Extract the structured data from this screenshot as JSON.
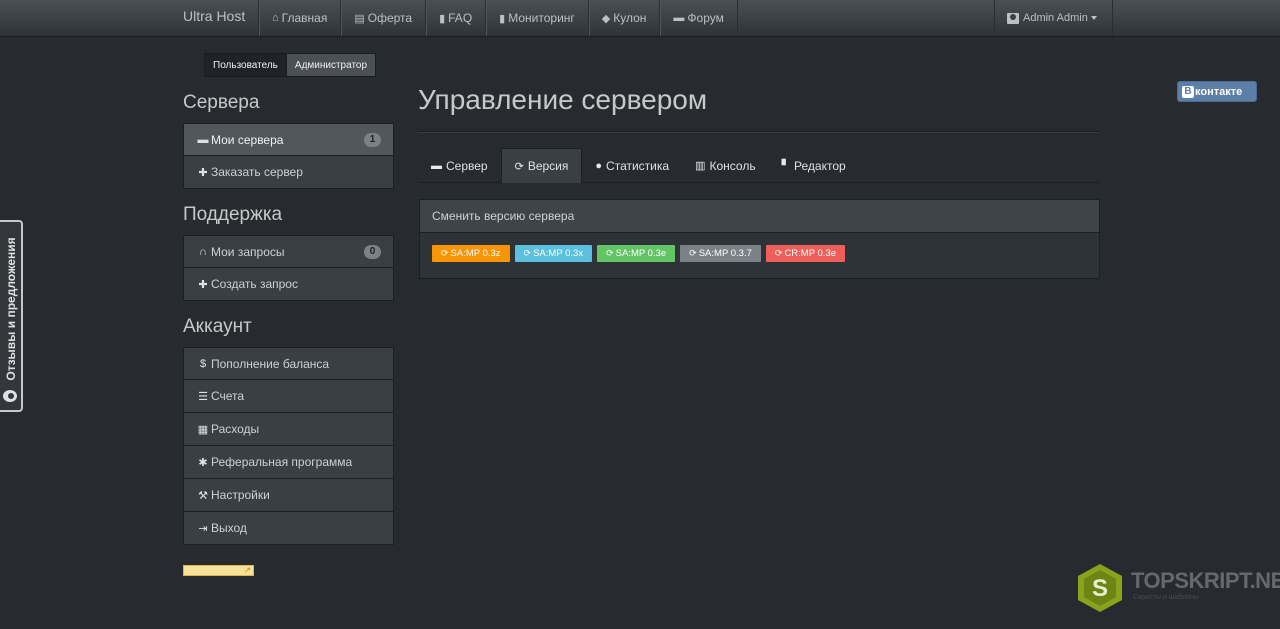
{
  "navbar": {
    "brand": "Ultra Host",
    "items": [
      {
        "label": "Главная",
        "icon": "home-icon"
      },
      {
        "label": "Оферта",
        "icon": "document-icon"
      },
      {
        "label": "FAQ",
        "icon": "book-icon"
      },
      {
        "label": "Мониторинг",
        "icon": "bar-chart-icon"
      },
      {
        "label": "Кулон",
        "icon": "tag-icon"
      },
      {
        "label": "Форум",
        "icon": "comment-icon"
      }
    ],
    "user": "Admin Admin"
  },
  "role_switch": {
    "user": "Пользователь",
    "admin": "Администратор"
  },
  "sidebar": {
    "servers_title": "Сервера",
    "servers": [
      {
        "label": "Мои сервера",
        "badge": "1"
      },
      {
        "label": "Заказать сервер"
      }
    ],
    "support_title": "Поддержка",
    "support": [
      {
        "label": "Мои запросы",
        "badge": "0"
      },
      {
        "label": "Создать запрос"
      }
    ],
    "account_title": "Аккаунт",
    "account": [
      {
        "label": "Пополнение баланса"
      },
      {
        "label": "Счета"
      },
      {
        "label": "Расходы"
      },
      {
        "label": "Реферальная программа"
      },
      {
        "label": "Настройки"
      },
      {
        "label": "Выход"
      }
    ]
  },
  "main": {
    "title": "Управление сервером",
    "tabs": [
      {
        "label": "Сервер"
      },
      {
        "label": "Версия"
      },
      {
        "label": "Статистика"
      },
      {
        "label": "Консоль"
      },
      {
        "label": "Редактор"
      }
    ],
    "panel": {
      "heading": "Сменить версию сервера",
      "versions": [
        {
          "label": "SA:MP 0.3z",
          "color": "#f89406"
        },
        {
          "label": "SA:MP 0.3x",
          "color": "#5bc0de"
        },
        {
          "label": "SA:MP 0.3e",
          "color": "#62c462"
        },
        {
          "label": "SA:MP 0.3.7",
          "color": "#7a8288"
        },
        {
          "label": "CR:MP 0.3e",
          "color": "#ee5f5b"
        }
      ]
    }
  },
  "feedback_tab": "Отзывы и предложения",
  "vk_button": {
    "letter": "В",
    "label": "контакте"
  },
  "watermark": {
    "text": "TOPSKRIPT.NET",
    "sub": "Скрипты и шаблоны"
  }
}
